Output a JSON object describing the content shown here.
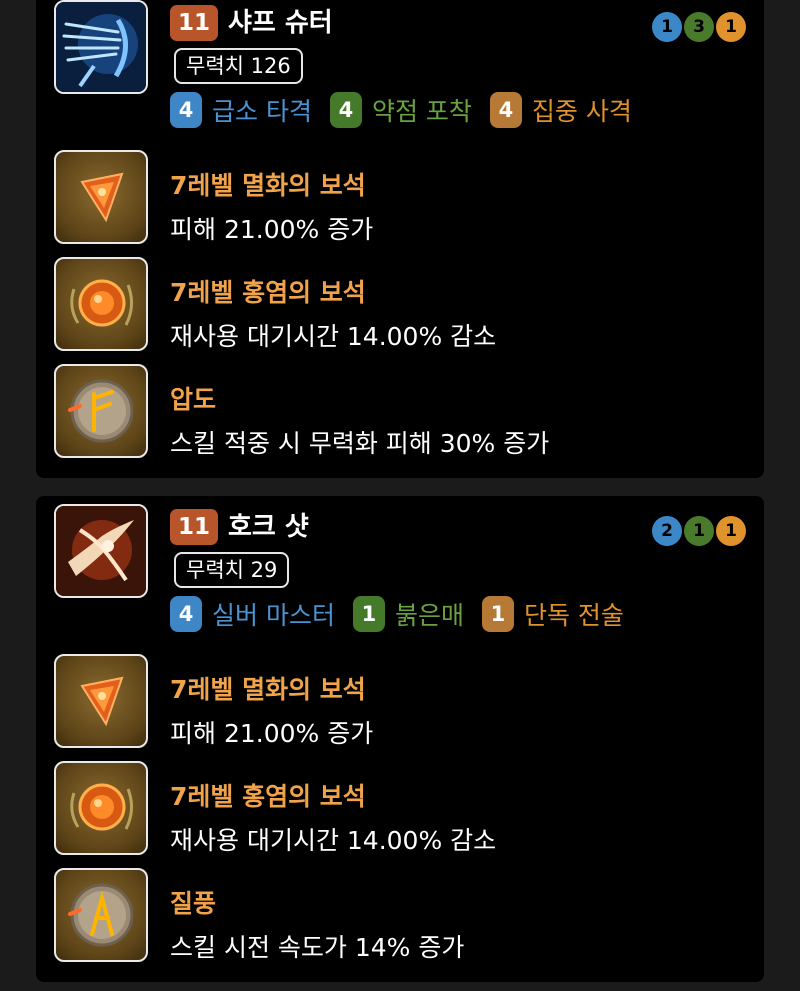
{
  "skills": [
    {
      "level": "11",
      "name": "샤프 슈터",
      "power_label": "무력치 126",
      "tripod_summary": [
        {
          "value": "1",
          "color": "blue"
        },
        {
          "value": "3",
          "color": "green"
        },
        {
          "value": "1",
          "color": "orange"
        }
      ],
      "tripods": [
        {
          "level": "4",
          "name": "급소 타격",
          "color": "blue"
        },
        {
          "level": "4",
          "name": "약점 포착",
          "color": "green"
        },
        {
          "level": "4",
          "name": "집중 사격",
          "color": "orange"
        }
      ],
      "icon": "sharp-shooter-skill-icon",
      "gems": [
        {
          "title": "7레벨 멸화의 보석",
          "desc": "피해 21.00% 증가",
          "icon": "annihilation-gem-icon"
        },
        {
          "title": "7레벨 홍염의 보석",
          "desc": "재사용 대기시간 14.00% 감소",
          "icon": "crimson-flame-gem-icon"
        }
      ],
      "rune": {
        "title": "압도",
        "desc": "스킬 적중 시 무력화 피해 30% 증가",
        "icon": "overwhelm-rune-icon"
      }
    },
    {
      "level": "11",
      "name": "호크 샷",
      "power_label": "무력치 29",
      "tripod_summary": [
        {
          "value": "2",
          "color": "blue"
        },
        {
          "value": "1",
          "color": "green"
        },
        {
          "value": "1",
          "color": "orange"
        }
      ],
      "tripods": [
        {
          "level": "4",
          "name": "실버 마스터",
          "color": "blue"
        },
        {
          "level": "1",
          "name": "붉은매",
          "color": "green"
        },
        {
          "level": "1",
          "name": "단독 전술",
          "color": "orange"
        }
      ],
      "icon": "hawk-shot-skill-icon",
      "gems": [
        {
          "title": "7레벨 멸화의 보석",
          "desc": "피해 21.00% 증가",
          "icon": "annihilation-gem-icon"
        },
        {
          "title": "7레벨 홍염의 보석",
          "desc": "재사용 대기시간 14.00% 감소",
          "icon": "crimson-flame-gem-icon"
        }
      ],
      "rune": {
        "title": "질풍",
        "desc": "스킬 시전 속도가 14% 증가",
        "icon": "gale-rune-icon"
      }
    }
  ],
  "colors": {
    "level_badge": "#b8552b",
    "gem_title": "#f0a34a",
    "tripod_blue": "#4a94d4",
    "tripod_green": "#6aa241",
    "tripod_orange": "#e0922d"
  }
}
